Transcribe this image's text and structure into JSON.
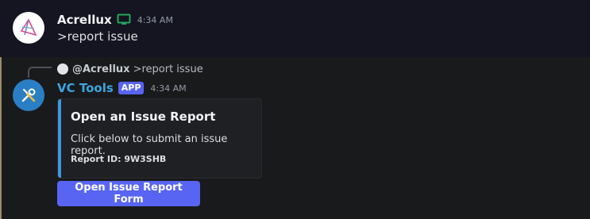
{
  "message1": {
    "author": "Acrellux",
    "timestamp": "4:34 AM",
    "content": ">report issue",
    "status_icon": "desktop-icon",
    "status_color": "#23a55a"
  },
  "message2": {
    "reply": {
      "author": "@Acrellux",
      "content": ">report issue"
    },
    "author": "VC Tools",
    "badge": "APP",
    "timestamp": "4:34 AM",
    "embed": {
      "title": "Open an Issue Report",
      "description": "Click below to submit an issue report.",
      "field": "Report ID: 9W3SHB",
      "accent_color": "#3b9ad9"
    },
    "button_label": "Open Issue Report Form"
  },
  "colors": {
    "background": "#141520",
    "button": "#5865f2",
    "bot_name": "#3ba6e0"
  }
}
